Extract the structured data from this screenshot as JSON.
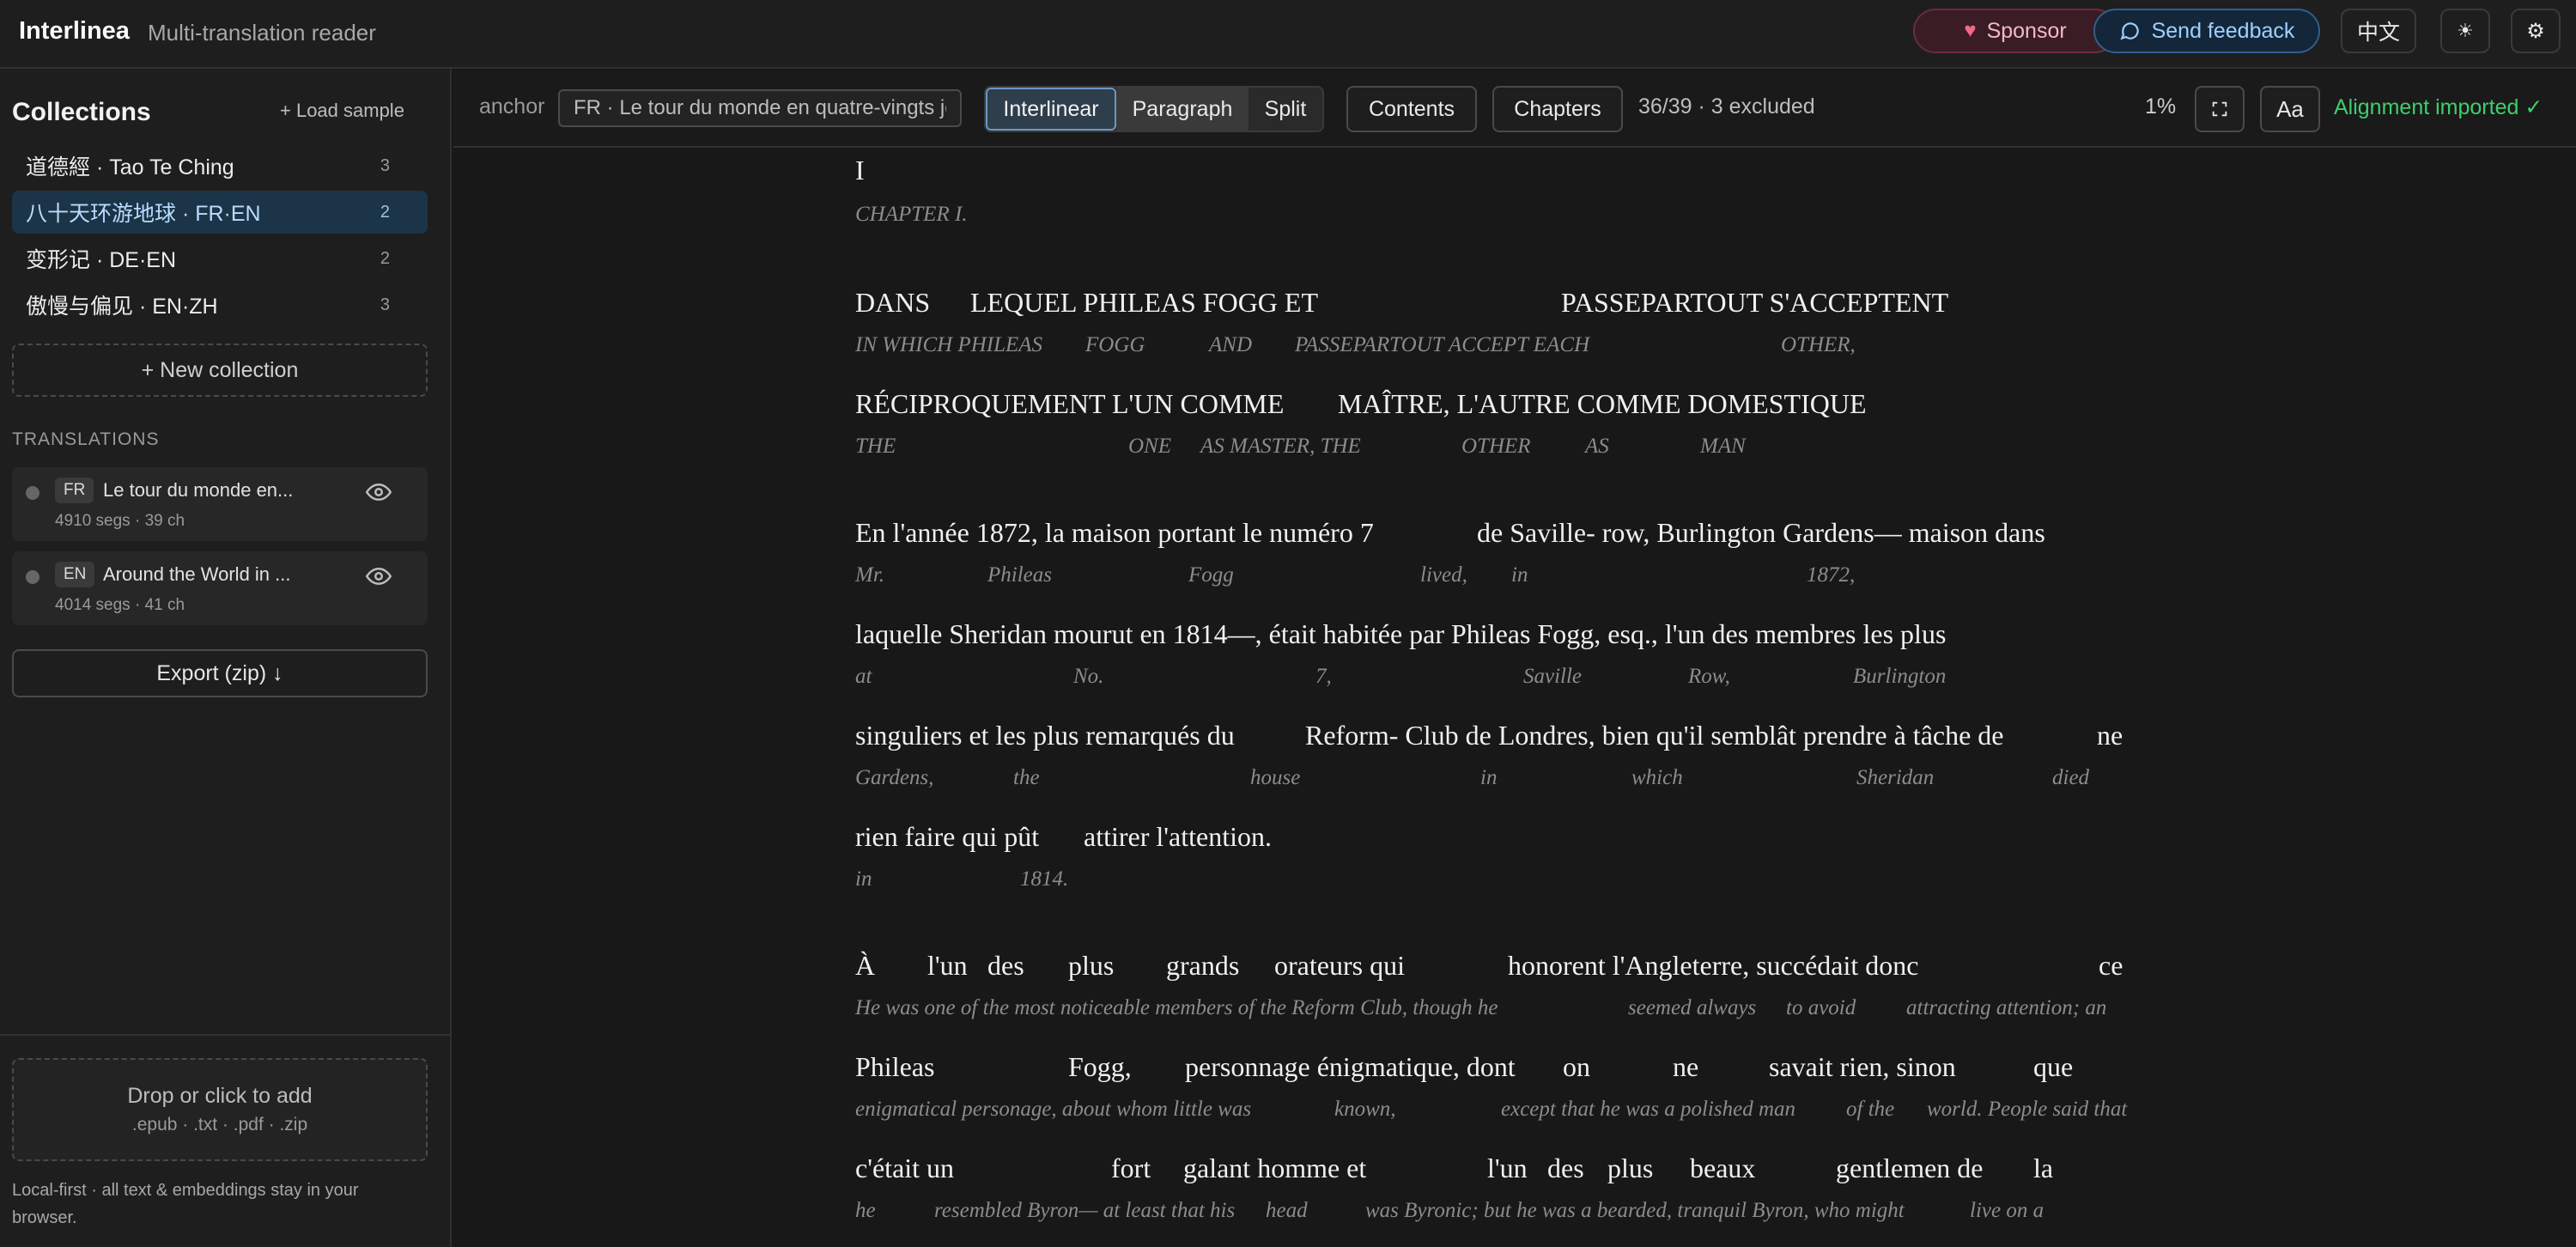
{
  "app": {
    "name": "Interlinea",
    "tagline": "Multi-translation reader",
    "sponsor_label": "Sponsor",
    "feedback_label": "Send feedback",
    "lang_label": "中文",
    "accent_color": "#3ecf6e",
    "sponsor_color": "#f3b9c6",
    "feedback_color": "#9fd0ff"
  },
  "sidebar": {
    "collections_title": "Collections",
    "load_sample_label": "+ Load sample",
    "collections": [
      {
        "label": "道德經 · Tao Te Ching",
        "count": "3"
      },
      {
        "label": "八十天环游地球 · FR·EN",
        "count": "2"
      },
      {
        "label": "变形记 · DE·EN",
        "count": "2"
      },
      {
        "label": "傲慢与偏见 · EN·ZH",
        "count": "3"
      }
    ],
    "new_collection_label": "+ New collection",
    "translations_head": "TRANSLATIONS",
    "translations": [
      {
        "code": "FR",
        "name": "Le tour du monde en...",
        "meta": "4910 segs · 39 ch"
      },
      {
        "code": "EN",
        "name": "Around the World in ...",
        "meta": "4014 segs · 41 ch"
      }
    ],
    "export_label": "Export (zip) ↓",
    "drop_title": "Drop or click to add",
    "drop_formats": ".epub · .txt · .pdf · .zip",
    "local_note": "Local-first · all text & embeddings stay in your browser."
  },
  "toolbar": {
    "anchor_label": "anchor",
    "anchor_value": "FR · Le tour du monde en quatre-vingts jours",
    "modes": [
      "Interlinear",
      "Paragraph",
      "Split"
    ],
    "contents_label": "Contents",
    "chapters_label": "Chapters",
    "count_text": "36/39 · 3 excluded",
    "progress_text": "1%",
    "font_label": "Aa",
    "alignment_status": "Alignment imported ✓"
  },
  "reader": {
    "src": [
      "I",
      "DANS",
      "LEQUEL PHILEAS FOGG ET",
      "PASSEPARTOUT S'ACCEPTENT",
      "RÉCIPROQUEMENT L'UN COMME",
      "MAÎTRE, L'AUTRE COMME DOMESTIQUE",
      "En l'année 1872, la maison portant le numéro 7",
      "de Saville- row, Burlington Gardens— maison dans",
      "laquelle Sheridan mourut en 1814—, était habitée par Phileas Fogg, esq., l'un des membres les plus",
      "singuliers et les plus remarqués du",
      "Reform- Club de Londres, bien qu'il semblât prendre à tâche de",
      "ne",
      "rien faire qui pût",
      "attirer l'attention.",
      "À",
      "l'un",
      "des",
      "plus",
      "grands",
      "orateurs qui",
      "honorent l'Angleterre, succédait donc",
      "ce",
      "Phileas",
      "Fogg,",
      "personnage énigmatique, dont",
      "on",
      "ne",
      "savait rien, sinon",
      "que",
      "c'était un",
      "fort",
      "galant homme et",
      "l'un",
      "des",
      "plus",
      "beaux",
      "gentlemen de",
      "la"
    ],
    "tr": [
      "CHAPTER I.",
      "IN WHICH PHILEAS",
      "FOGG",
      "AND",
      "PASSEPARTOUT ACCEPT EACH",
      "OTHER,",
      "THE",
      "ONE",
      "AS MASTER, THE",
      "OTHER",
      "AS",
      "MAN",
      "Mr.",
      "Phileas",
      "Fogg",
      "lived,",
      "in",
      "1872,",
      "at",
      "No.",
      "7,",
      "Saville",
      "Row,",
      "Burlington",
      "Gardens,",
      "the",
      "house",
      "in",
      "which",
      "Sheridan",
      "died",
      "in",
      "1814.",
      "He was one of the most noticeable members of the Reform Club, though he",
      "seemed always",
      "to avoid",
      "attracting attention; an",
      "enigmatical personage, about whom little was",
      "known,",
      "except that he was a polished man",
      "of the",
      "world. People said that",
      "he",
      "resembled Byron— at least that his",
      "head",
      "was Byronic; but he was a bearded, tranquil Byron, who might",
      "live on a"
    ]
  }
}
